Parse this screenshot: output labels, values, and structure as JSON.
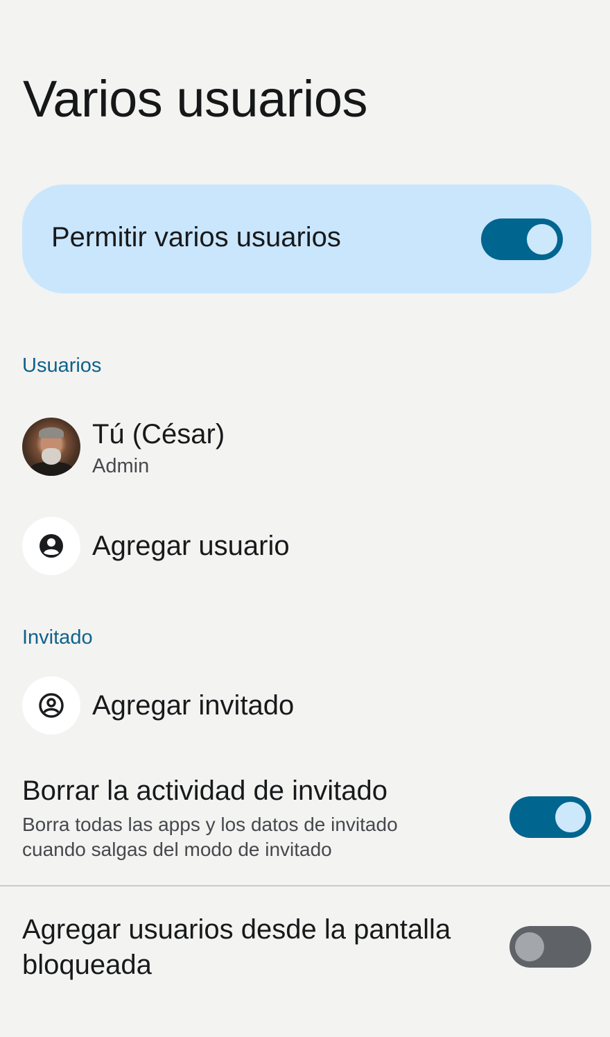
{
  "page": {
    "title": "Varios usuarios"
  },
  "main_toggle": {
    "label": "Permitir varios usuarios",
    "checked": true
  },
  "sections": {
    "users": {
      "header": "Usuarios",
      "current_user": {
        "name": "Tú (César)",
        "role": "Admin"
      },
      "add_user_label": "Agregar usuario"
    },
    "guest": {
      "header": "Invitado",
      "add_guest_label": "Agregar invitado",
      "delete_activity": {
        "title": "Borrar la actividad de invitado",
        "description": "Borra todas las apps y los datos de invitado cuando salgas del modo de invitado",
        "checked": true
      }
    },
    "lockscreen": {
      "title": "Agregar usuarios desde la pantalla bloqueada",
      "checked": false
    }
  },
  "colors": {
    "accent": "#00658f",
    "card_bg": "#c9e6fc",
    "section_header": "#0f628a",
    "background": "#f3f3f2"
  },
  "icons": [
    "account-circle-icon",
    "account-circle-icon"
  ]
}
